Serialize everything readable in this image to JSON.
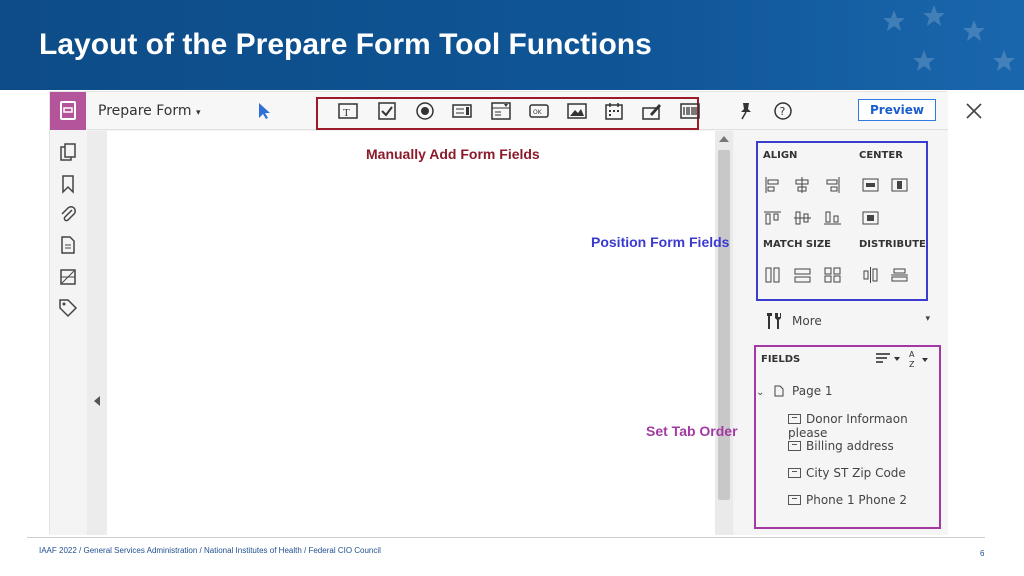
{
  "slide": {
    "title": "Layout of the Prepare Form Tool Functions",
    "page_number": "6",
    "footer": "IAAF 2022  /  General Services Administration  /  National Institutes of Health  /  Federal CIO Council"
  },
  "app": {
    "tool_name": "Prepare Form",
    "preview_label": "Preview",
    "sidebar_icons": [
      "pages-icon",
      "bookmark-icon",
      "attachment-icon",
      "document-icon",
      "compare-icon",
      "tag-icon"
    ],
    "toolbar_icons": [
      "pointer-icon",
      "text-field-icon",
      "checkbox-icon",
      "radio-icon",
      "list-box-icon",
      "dropdown-icon",
      "button-icon",
      "image-icon",
      "date-icon",
      "signature-icon",
      "barcode-icon",
      "pin-icon",
      "help-icon",
      "close-icon"
    ]
  },
  "panel": {
    "align": "ALIGN",
    "center": "CENTER",
    "match_size": "MATCH SIZE",
    "distribute": "DISTRIBUTE",
    "more": "More",
    "fields_header": "FIELDS",
    "page": "Page 1",
    "fields": [
      "Donor Informaon please",
      "Billing address",
      "City ST  Zip Code",
      "Phone 1  Phone 2"
    ]
  },
  "callouts": {
    "manual": "Manually Add Form Fields",
    "position": "Position Form Fields",
    "tab_order": "Set Tab Order"
  },
  "colors": {
    "banner": "#0f5596",
    "manual": "#8b1a2b",
    "position": "#3a3ad0",
    "tab_order": "#a33aa3",
    "prepare_accent": "#b4549a"
  }
}
